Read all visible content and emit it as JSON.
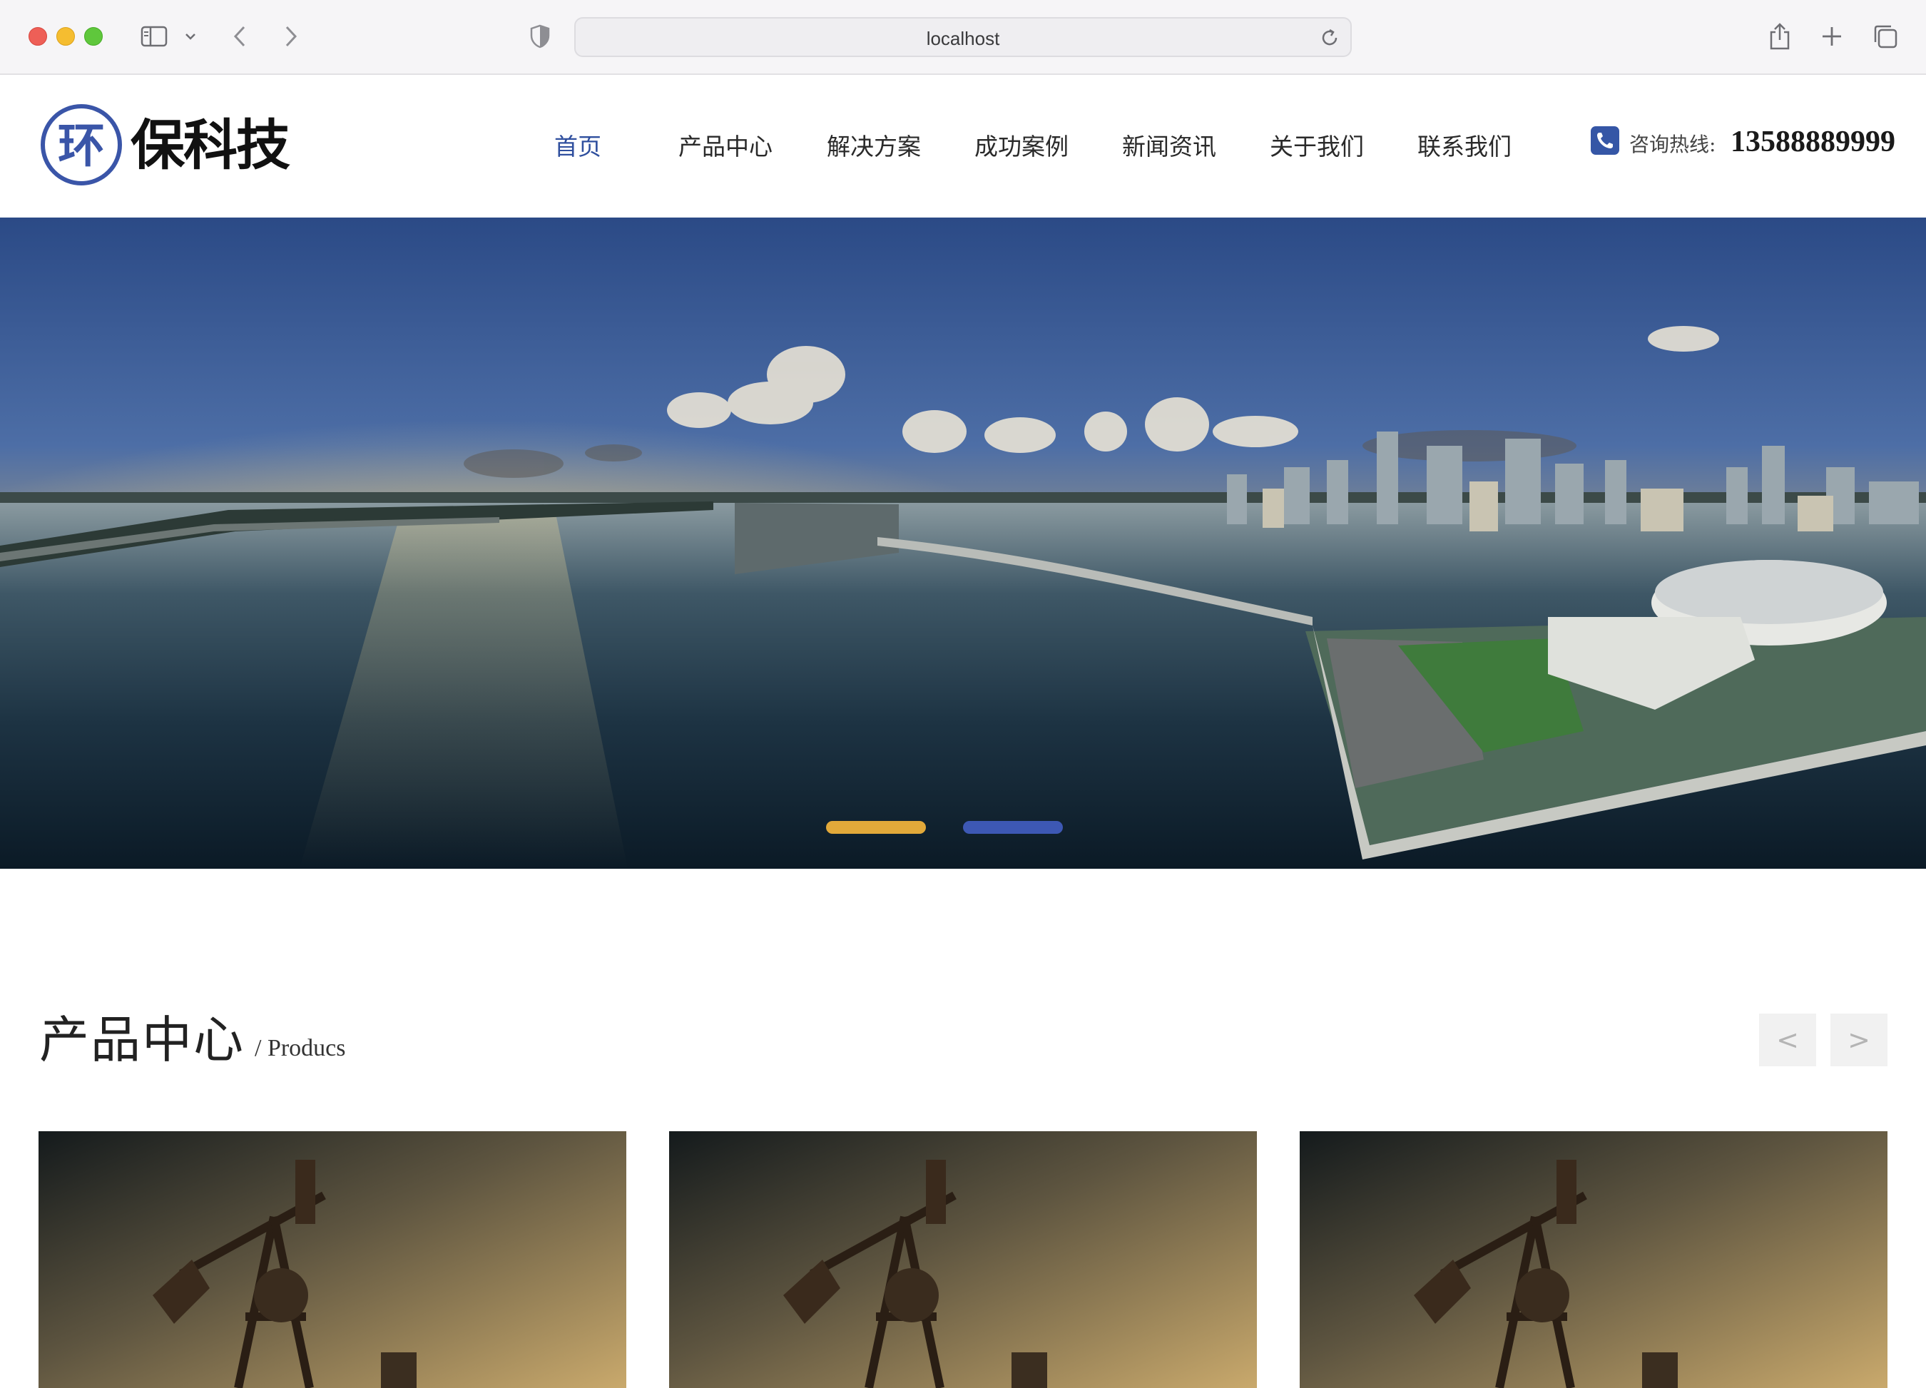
{
  "browser": {
    "url": "localhost",
    "icons": [
      "sidebar-icon",
      "chevron-down-icon",
      "back-arrow-icon",
      "forward-arrow-icon",
      "shield-icon",
      "reload-icon",
      "share-icon",
      "plus-icon",
      "tabs-overview-icon"
    ]
  },
  "header": {
    "logo_mark_char": "环",
    "logo_text": "保科技",
    "nav": [
      {
        "label": "首页",
        "active": true
      },
      {
        "label": "产品中心",
        "active": false
      },
      {
        "label": "解决方案",
        "active": false
      },
      {
        "label": "成功案例",
        "active": false
      },
      {
        "label": "新闻资讯",
        "active": false
      },
      {
        "label": "关于我们",
        "active": false
      },
      {
        "label": "联系我们",
        "active": false
      }
    ],
    "hotline_label": "咨询热线:",
    "hotline_number": "13588889999"
  },
  "hero": {
    "image": "city-skyline-bay-panorama",
    "slides": 2,
    "active_slide": 1
  },
  "products": {
    "title": "产品中心",
    "subtitle": "/ Producs",
    "prev_label": "<",
    "next_label": ">",
    "cards": [
      {
        "image": "oil-pumpjack-sunset"
      },
      {
        "image": "oil-pumpjack-sunset"
      },
      {
        "image": "oil-pumpjack-sunset"
      }
    ]
  },
  "colors": {
    "accent_blue": "#2f4f9e",
    "dot_active": "#e2a93a",
    "dot_inactive": "#3d58b4"
  }
}
